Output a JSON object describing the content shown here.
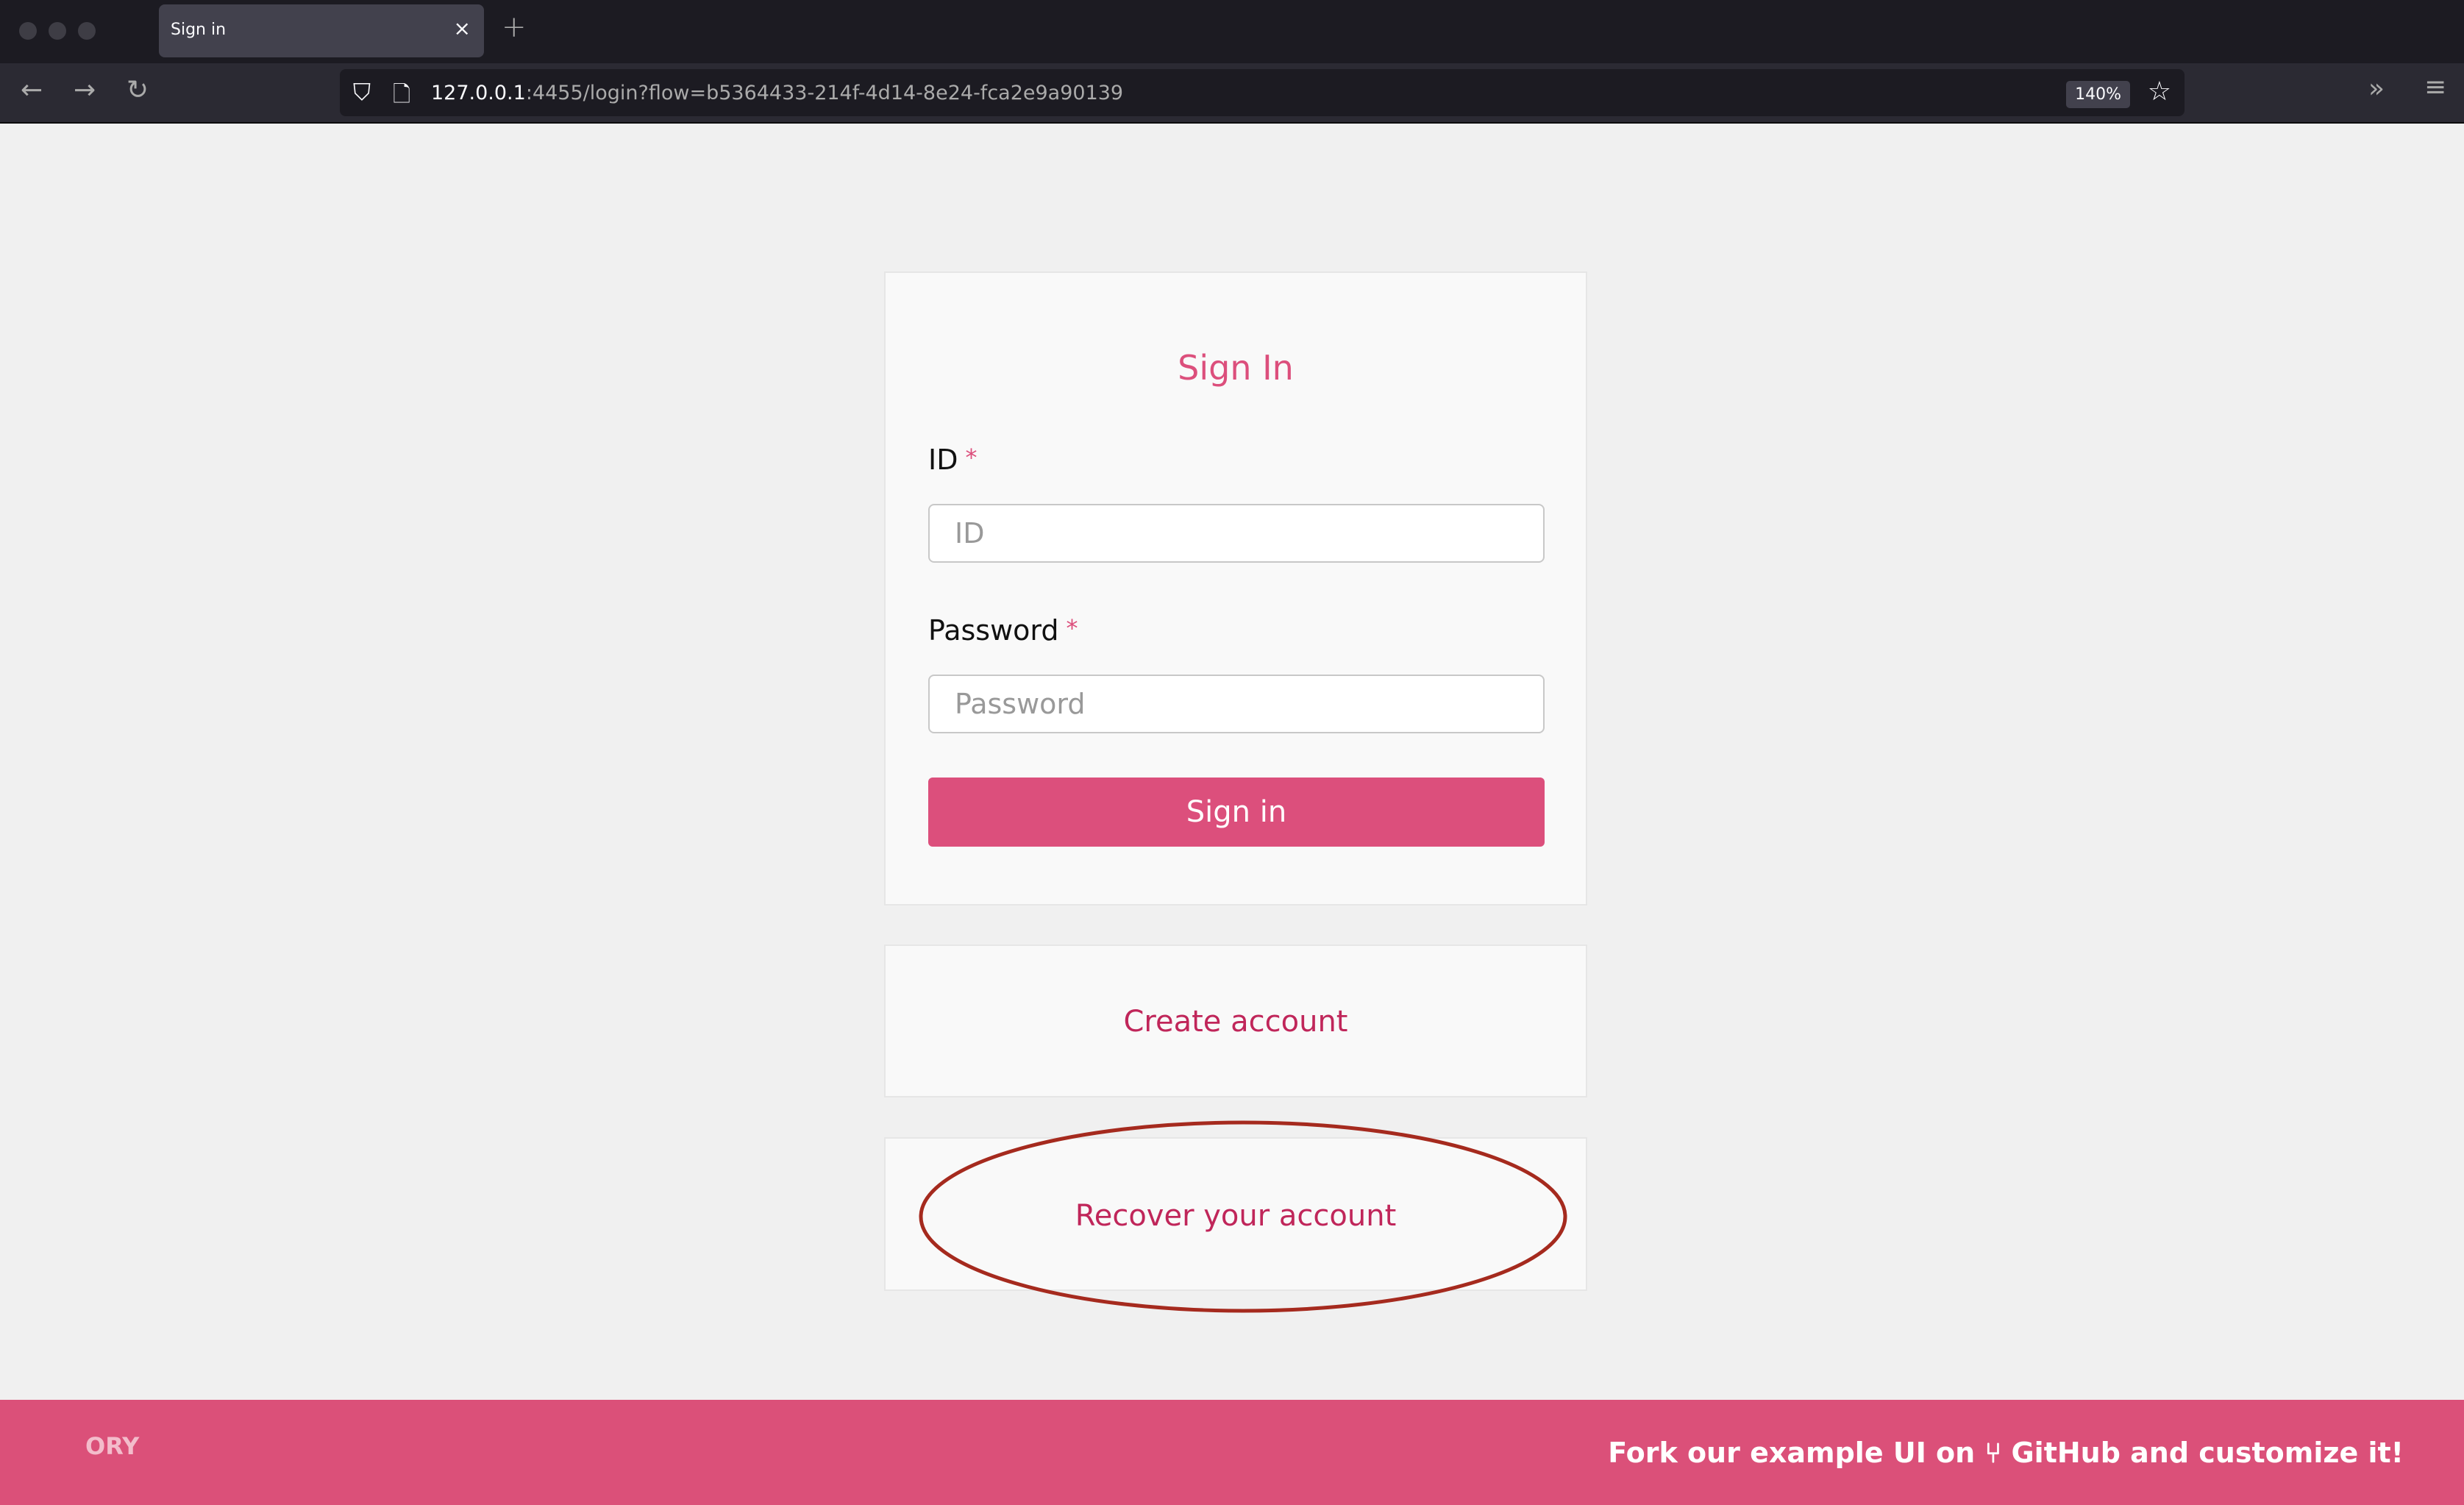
{
  "browser": {
    "tab_title": "Sign in",
    "url_host": "127.0.0.1",
    "url_rest": ":4455/login?flow=b5364433-214f-4d14-8e24-fca2e9a90139",
    "zoom": "140%"
  },
  "form": {
    "title": "Sign In",
    "id_label": "ID",
    "id_placeholder": "ID",
    "required": "*",
    "password_label": "Password",
    "password_placeholder": "Password",
    "submit": "Sign in"
  },
  "links": {
    "create": "Create account",
    "recover": "Recover your account"
  },
  "footer": {
    "logo": "ORY",
    "fork_text": "Fork our example UI on ⑂ GitHub and customize it!"
  },
  "colors": {
    "accent": "#dc4f7c",
    "footer": "#db5079",
    "annotation": "#a52a1e"
  }
}
